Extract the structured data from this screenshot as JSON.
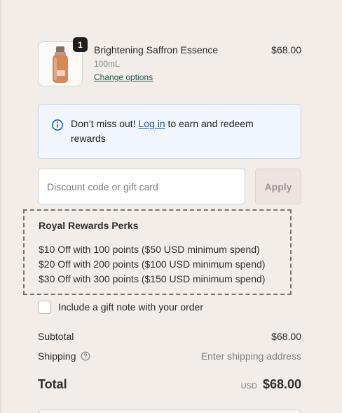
{
  "product": {
    "name": "Brightening Saffron Essence",
    "size": "100mL",
    "change_link": "Change options",
    "price": "$68.00",
    "quantity": "1",
    "image_icon": "product-bottle-icon"
  },
  "notice": {
    "icon": "info-icon",
    "prefix": "Don’t miss out! ",
    "link": "Log in",
    "suffix": " to earn and redeem rewards"
  },
  "discount": {
    "placeholder": "Discount code or gift card",
    "apply_label": "Apply"
  },
  "perks": {
    "title": "Royal Rewards Perks",
    "items": [
      "$10 Off with 100 points ($50 USD minimum spend)",
      "$20 Off with 200 points ($100 USD minimum spend)",
      "$30 Off with 300 points ($150 USD minimum spend)"
    ]
  },
  "gift_note": {
    "label": "Include a gift note with your order",
    "checked": false
  },
  "summary": {
    "subtotal_label": "Subtotal",
    "subtotal_value": "$68.00",
    "shipping_label": "Shipping",
    "shipping_help_icon": "question-circle-icon",
    "shipping_value": "Enter shipping address",
    "total_label": "Total",
    "currency": "USD",
    "total_value": "$68.00"
  },
  "colors": {
    "background": "#f2ede9",
    "notice_bg": "#f0f6fc",
    "link": "#1e5a9c"
  }
}
